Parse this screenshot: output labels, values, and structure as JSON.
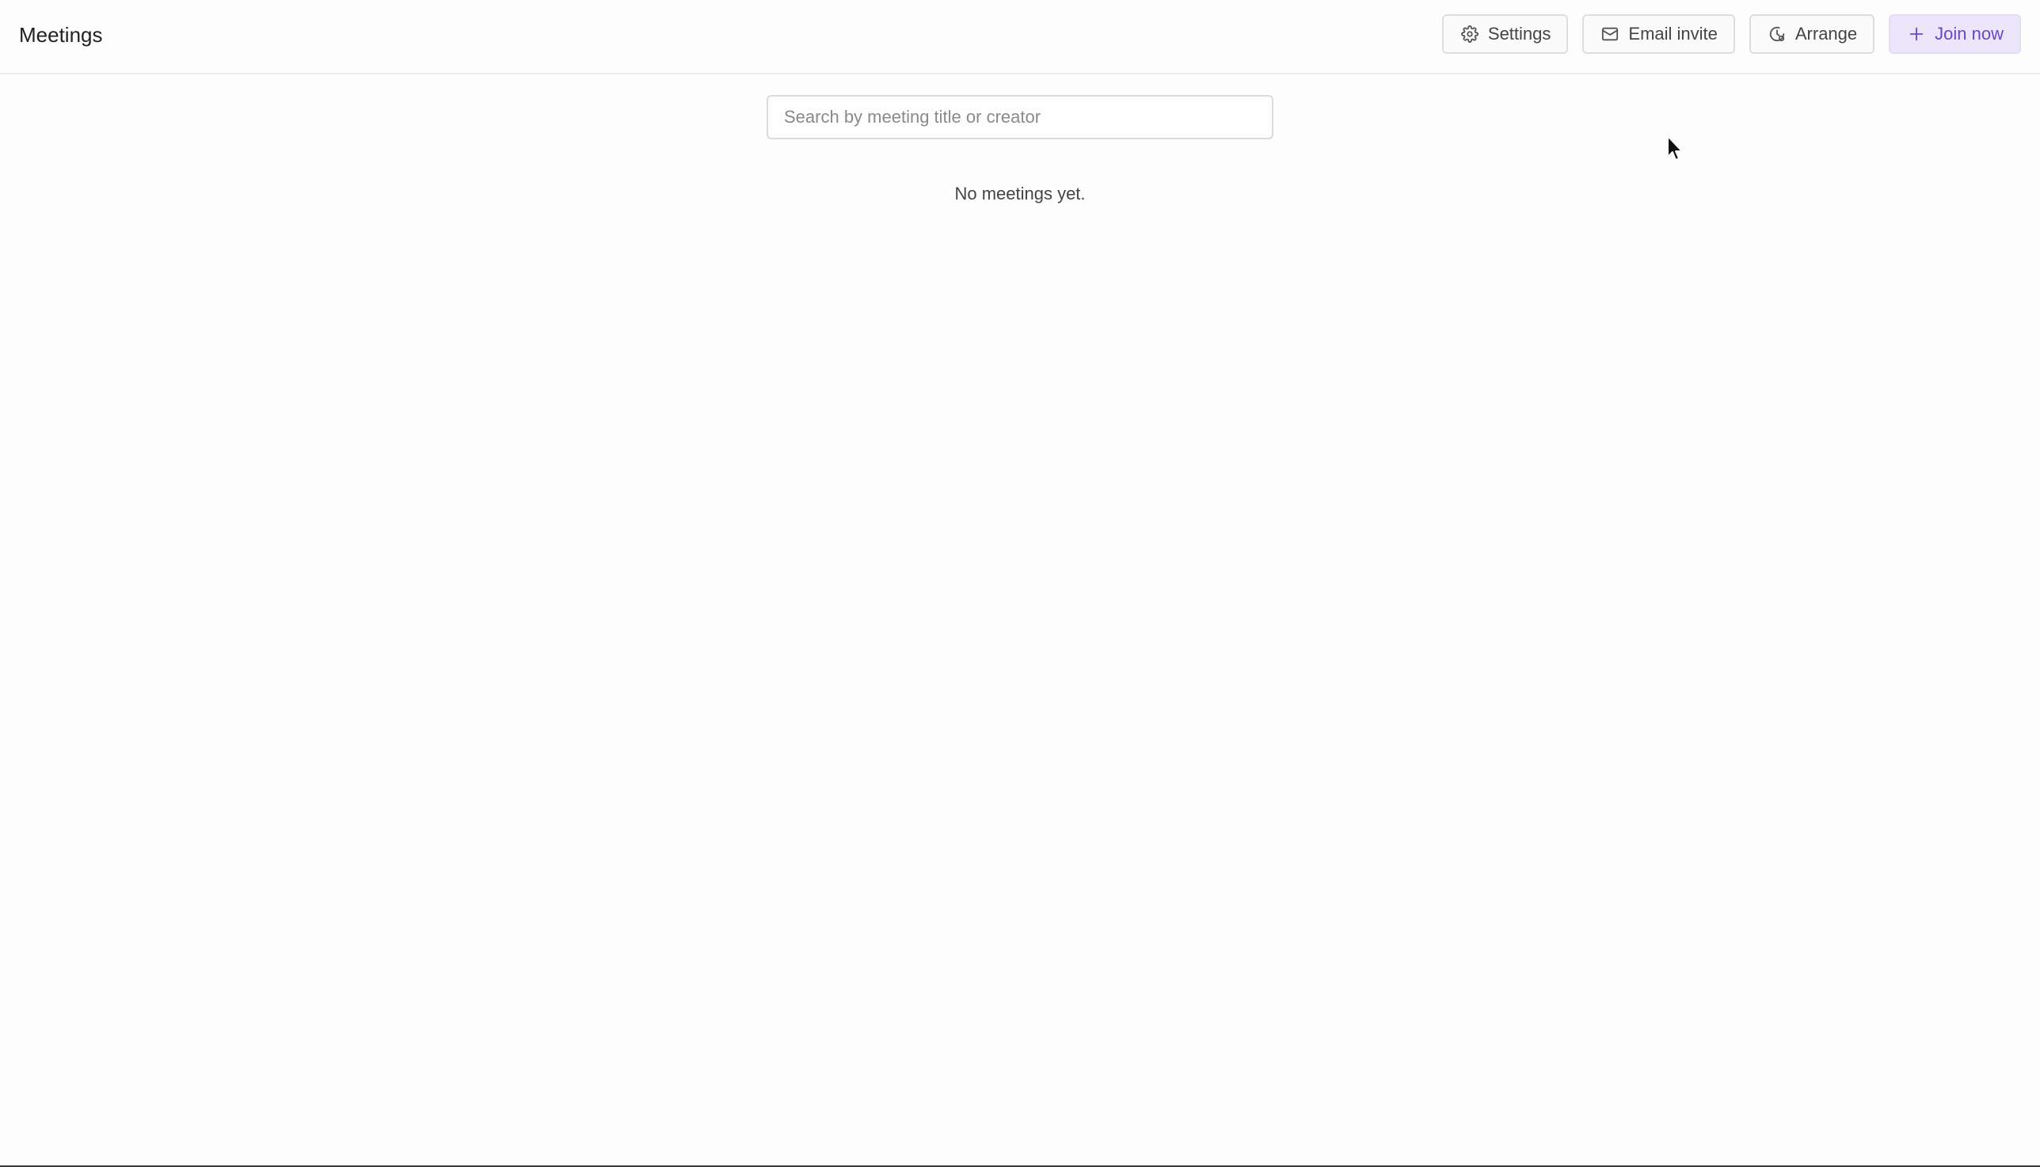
{
  "header": {
    "title": "Meetings"
  },
  "toolbar": {
    "settings_label": "Settings",
    "email_invite_label": "Email invite",
    "arrange_label": "Arrange",
    "join_now_label": "Join now"
  },
  "search": {
    "placeholder": "Search by meeting title or creator",
    "value": ""
  },
  "empty_state": {
    "message": "No meetings yet."
  },
  "icons": {
    "settings": "gear-icon",
    "email_invite": "mail-icon",
    "arrange": "clock-icon",
    "join_now": "plus-icon"
  },
  "colors": {
    "accent": "#6b45c9",
    "accent_bg": "#ece6fb",
    "border": "#dedede"
  }
}
